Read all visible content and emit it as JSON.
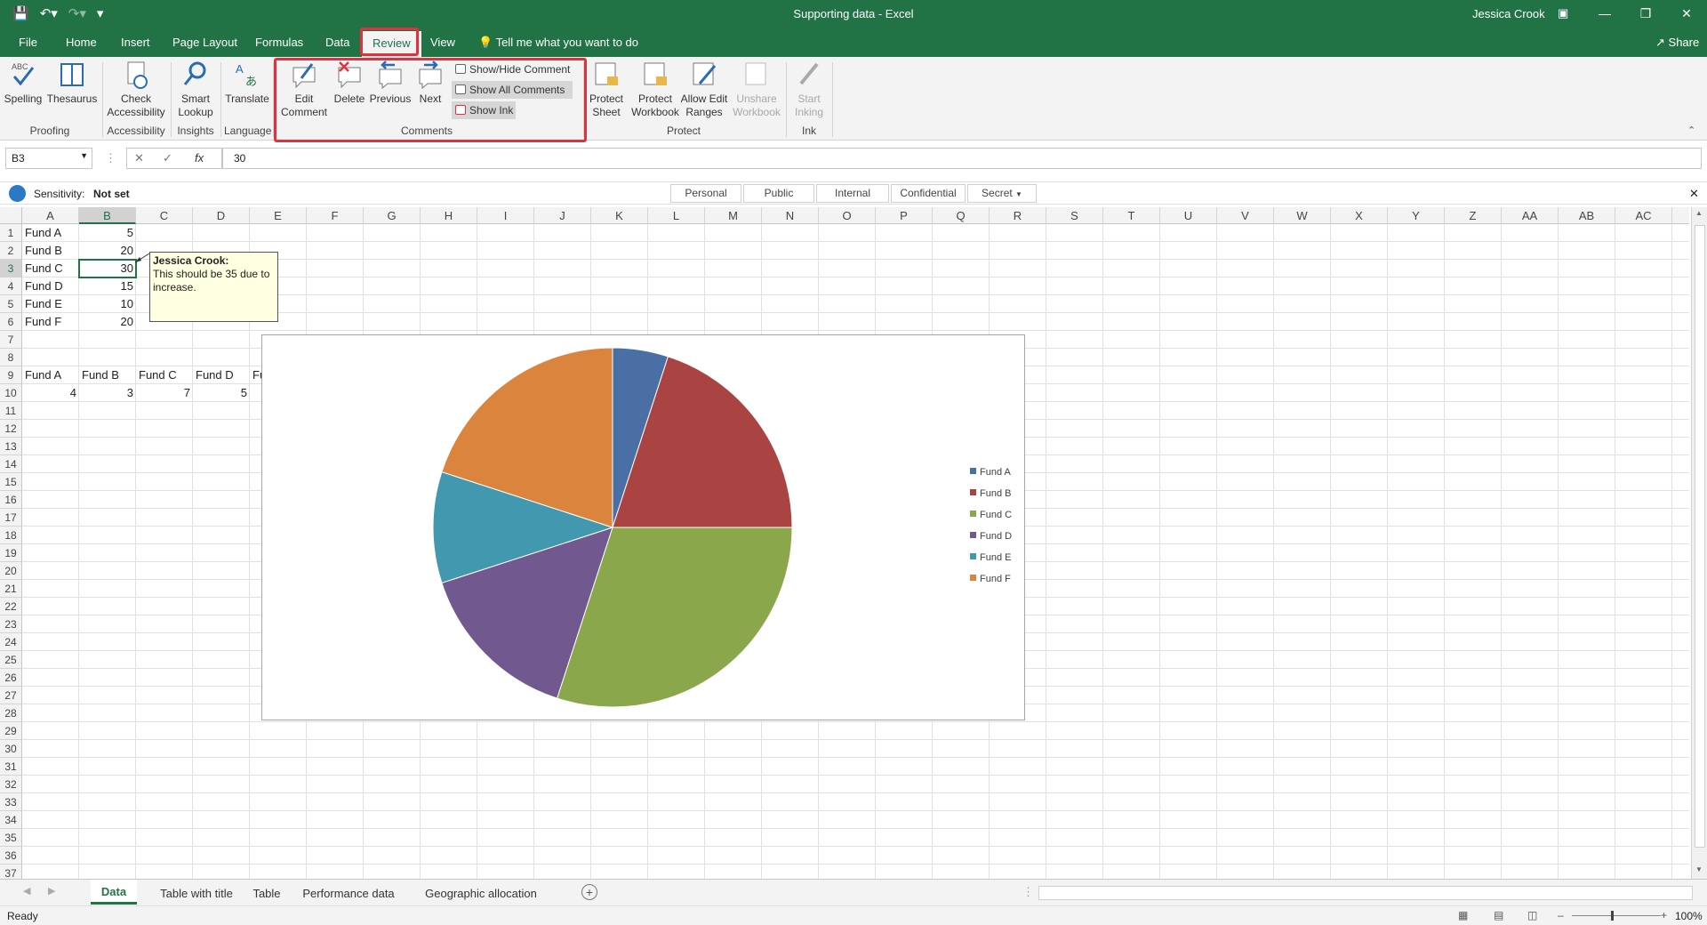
{
  "app": {
    "doc_title": "Supporting data  -  Excel",
    "user": "Jessica Crook"
  },
  "tabs": [
    "File",
    "Home",
    "Insert",
    "Page Layout",
    "Formulas",
    "Data",
    "Review",
    "View"
  ],
  "active_tab": "Review",
  "tell_me": "Tell me what you want to do",
  "share": "Share",
  "ribbon": {
    "proofing": {
      "spelling": "Spelling",
      "thesaurus": "Thesaurus",
      "label": "Proofing"
    },
    "accessibility": {
      "check1": "Check",
      "check2": "Accessibility",
      "label": "Accessibility"
    },
    "insights": {
      "smart1": "Smart",
      "smart2": "Lookup",
      "label": "Insights"
    },
    "language": {
      "translate": "Translate",
      "label": "Language"
    },
    "comments": {
      "edit1": "Edit",
      "edit2": "Comment",
      "delete": "Delete",
      "previous": "Previous",
      "next": "Next",
      "show_hide": "Show/Hide Comment",
      "show_all": "Show All Comments",
      "show_ink": "Show Ink",
      "label": "Comments"
    },
    "protect": {
      "sheet1": "Protect",
      "sheet2": "Sheet",
      "wb1": "Protect",
      "wb2": "Workbook",
      "ranges1": "Allow Edit",
      "ranges2": "Ranges",
      "unshare1": "Unshare",
      "unshare2": "Workbook",
      "label": "Protect"
    },
    "ink": {
      "start1": "Start",
      "start2": "Inking",
      "label": "Ink"
    }
  },
  "formula_bar": {
    "name_box": "B3",
    "fx": "fx",
    "value": "30"
  },
  "sensitivity": {
    "label": "Sensitivity:",
    "value": "Not set",
    "options": [
      "Personal",
      "Public",
      "Internal",
      "Confidential",
      "Secret"
    ]
  },
  "columns": [
    "A",
    "B",
    "C",
    "D",
    "E",
    "F",
    "G",
    "H",
    "I",
    "J",
    "K",
    "L",
    "M",
    "N",
    "O",
    "P",
    "Q",
    "R",
    "S",
    "T",
    "U",
    "V",
    "W",
    "X",
    "Y",
    "Z",
    "AA",
    "AB",
    "AC"
  ],
  "rows": [
    "1",
    "2",
    "3",
    "4",
    "5",
    "6",
    "7",
    "8",
    "9",
    "10",
    "11",
    "12",
    "13",
    "14",
    "15",
    "16",
    "17",
    "18",
    "19",
    "20",
    "21",
    "22",
    "23",
    "24",
    "25",
    "26",
    "27",
    "28",
    "29",
    "30",
    "31",
    "32",
    "33",
    "34",
    "35",
    "36",
    "37"
  ],
  "cells": {
    "a1": "Fund A",
    "b1": "5",
    "a2": "Fund B",
    "b2": "20",
    "a3": "Fund C",
    "b3": "30",
    "a4": "Fund D",
    "b4": "15",
    "a5": "Fund E",
    "b5": "10",
    "a6": "Fund F",
    "b6": "20",
    "a9": "Fund A",
    "b9": "Fund B",
    "c9": "Fund C",
    "d9": "Fund D",
    "e9": "Fu",
    "a10": "4",
    "b10": "3",
    "c10": "7",
    "d10": "5"
  },
  "comment": {
    "author": "Jessica Crook:",
    "text": "This should be 35 due to increase."
  },
  "chart_data": {
    "type": "pie",
    "categories": [
      "Fund A",
      "Fund B",
      "Fund C",
      "Fund D",
      "Fund E",
      "Fund F"
    ],
    "values": [
      5,
      20,
      30,
      15,
      10,
      20
    ],
    "colors": [
      "#4a6fa5",
      "#a94442",
      "#8aa84b",
      "#71588f",
      "#4198af",
      "#db843d"
    ],
    "legend_position": "right"
  },
  "sheet_tabs": [
    "Data",
    "Table with title",
    "Table",
    "Performance data",
    "Geographic allocation"
  ],
  "active_sheet": "Data",
  "status": {
    "ready": "Ready",
    "zoom": "100%"
  }
}
